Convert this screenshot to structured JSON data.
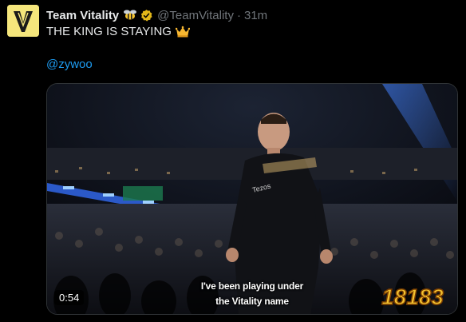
{
  "tweet": {
    "display_name": "Team Vitality",
    "handle": "@TeamVitality",
    "separator": "·",
    "time": "31m",
    "text": "THE KING IS STAYING",
    "mention": "@zywoo"
  },
  "icons": {
    "name_emoji": "bee-icon",
    "verified": "verified-badge-icon",
    "text_emoji": "crown-icon"
  },
  "media": {
    "duration": "0:54",
    "subtitle_line1": "I've been playing under",
    "subtitle_line2": "the Vitality name",
    "watermark_text": "18183"
  },
  "colors": {
    "background": "#000000",
    "text": "#e7e9ea",
    "muted": "#71767b",
    "link": "#1d9bf0",
    "verified_gold": "#e2b719"
  }
}
